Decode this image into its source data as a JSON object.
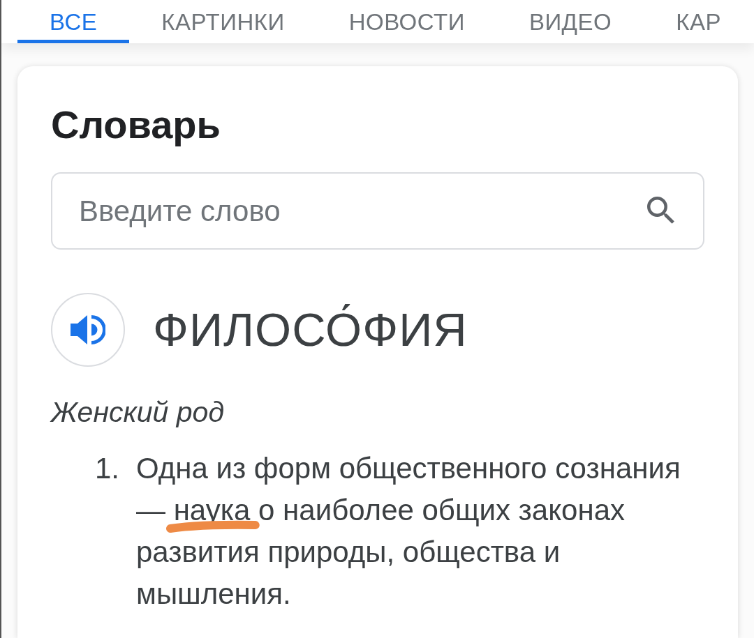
{
  "tabs": [
    {
      "label": "ВСЕ",
      "selected": true
    },
    {
      "label": "КАРТИНКИ",
      "selected": false
    },
    {
      "label": "НОВОСТИ",
      "selected": false
    },
    {
      "label": "ВИДЕО",
      "selected": false
    },
    {
      "label": "КАР",
      "selected": false
    }
  ],
  "dictionary": {
    "title": "Словарь",
    "search": {
      "placeholder": "Введите слово"
    },
    "word": "ФИЛОСО́ФИЯ",
    "grammar": "Женский род",
    "definitions": [
      {
        "number": "1.",
        "parts": [
          {
            "text": "Одна из форм общественного сознания — ",
            "underlined": false
          },
          {
            "text": "наука",
            "underlined": true
          },
          {
            "text": " о наиболее общих законах развития природы, общества и мышления.",
            "underlined": false
          }
        ]
      }
    ]
  }
}
